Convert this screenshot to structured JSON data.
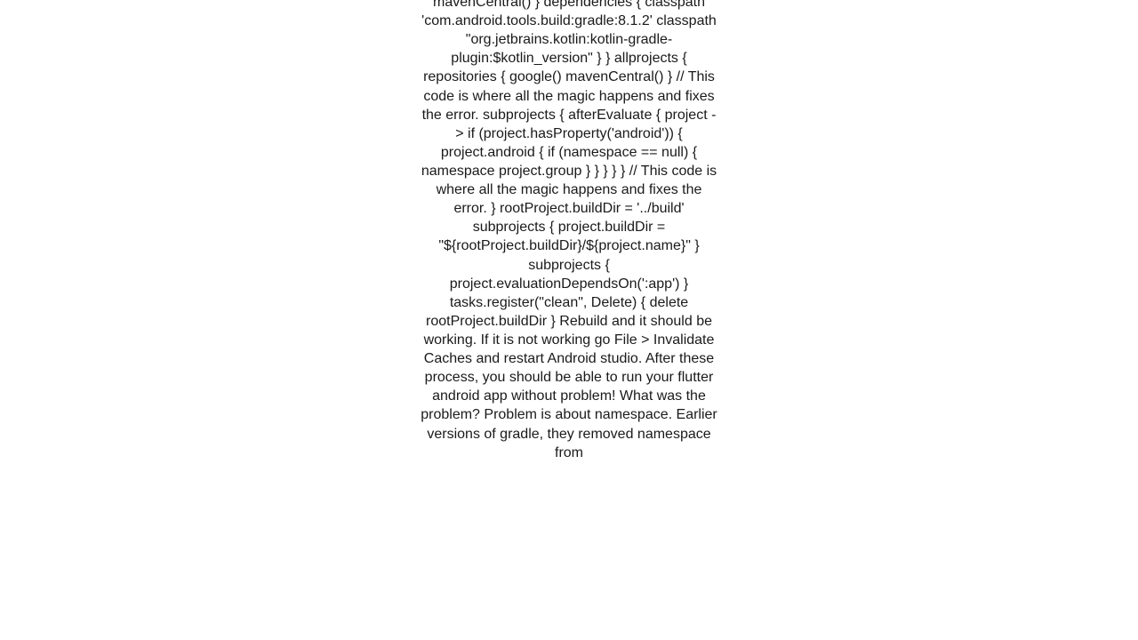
{
  "article": {
    "body": "mavenCentral()     }     dependencies {         classpath 'com.android.tools.build:gradle:8.1.2'         classpath \"org.jetbrains.kotlin:kotlin-gradle-plugin:$kotlin_version\"     } }  allprojects {     repositories {         google()         mavenCentral()     }     // This code is where all the magic happens and fixes the error.     subprojects {         afterEvaluate { project ->             if (project.hasProperty('android')) {                 project.android {                     if (namespace == null) {                         namespace project.group                     }                 }             }         }     }     // This code is where all the magic happens and fixes the error. }  rootProject.buildDir = '../build' subprojects {     project.buildDir = \"${rootProject.buildDir}/${project.name}\" } subprojects {     project.evaluationDependsOn(':app') }  tasks.register(\"clean\", Delete) {     delete rootProject.buildDir }   Rebuild and it should be working. If it is not working go File > Invalidate Caches and restart Android studio. After these process, you should be able to run your flutter android app without problem! What was the problem? Problem is about namespace. Earlier versions of gradle, they removed namespace from"
  }
}
